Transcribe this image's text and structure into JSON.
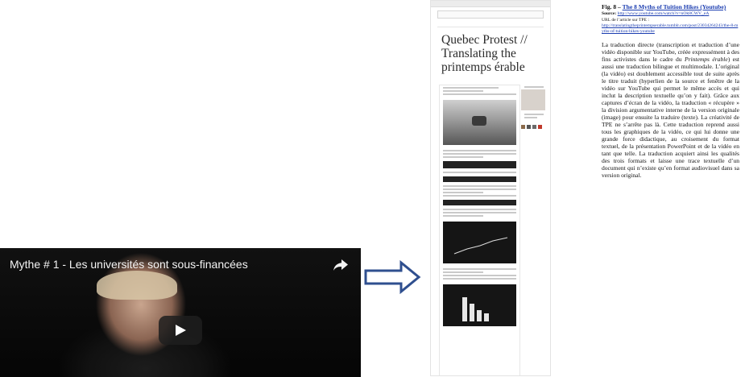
{
  "video": {
    "title": "Mythe # 1 - Les universités sont sous-financées",
    "share_icon": "share-arrow-icon",
    "play_icon": "play-icon"
  },
  "arrow": {
    "icon": "right-double-arrow-icon",
    "color": "#2f4f8f"
  },
  "blog": {
    "title_line1": "Quebec Protest //",
    "title_line2": "Translating the",
    "title_line3": "printemps érable"
  },
  "caption": {
    "fig_prefix": "Fig. 8 – ",
    "fig_title": "The 8 Myths of Tuition Hikes (Youtube)",
    "source_label": "Source:",
    "source_url": "http://www.youtube.com/watch?v=nOk8CWV_eA",
    "url_label": "URL de l’article sur TPE :",
    "article_url": "http://translatingtheprintempserable.tumblr.com/post/23034264243/the-8-myths-of-tuition-hikes-youtube",
    "paragraph_part1": "La traduction directe (transcription et traduction d’une vidéo disponible sur YouTube, créée expressément à des fins activistes dans le cadre du ",
    "paragraph_italic": "Printemps érable",
    "paragraph_part2": ") est aussi une traduction bilingue et multimodale. L’original (la vidéo) est doublement accessible tout de suite après le titre traduit (hyperlien de la source et fenêtre de la vidéo sur YouTube qui permet le même accès et qui inclut la description textuelle qu’on y fait). Grâce aux captures d’écran de la vidéo, la traduction « récupère » la division argumentative interne de la version originale (image) pour ensuite la traduire (texte). La créativité de TPE ne s’arrête pas là. Cette traduction reprend aussi tous les graphiques de la vidéo, ce qui lui donne une grande force didactique, au croisement du format textuel, de la présentation PowerPoint et de la vidéo en tant que telle. La traduction acquiert ainsi les qualités des trois formats et laisse une trace textuelle d’un document qui n’existe qu’en format audiovisuel dans sa version original."
  }
}
